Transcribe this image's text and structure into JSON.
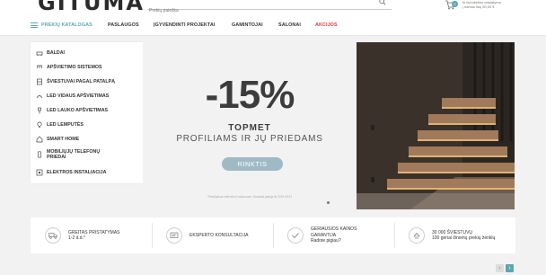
{
  "header": {
    "logo": "GITUMA",
    "search_placeholder": "Prekių paieška",
    "cart_count": "0",
    "cart_line1": "Iš išmokėtino pristatymo",
    "cart_line2": "į namus likę 50,00 €"
  },
  "nav": {
    "catalog": "PREKIŲ KATALOGAS",
    "items": [
      "PASLAUGOS",
      "ĮGYVENDINTI PROJEKTAI",
      "GAMINTOJAI",
      "SALONAI",
      "AKCIJOS"
    ]
  },
  "sidebar": {
    "items": [
      {
        "label": "BALDAI",
        "icon": "sofa-icon"
      },
      {
        "label": "APŠVIETIMO SISTEMOS",
        "icon": "track-light-icon"
      },
      {
        "label": "ŠVIESTUVAI PAGAL PATALPĄ",
        "icon": "lamp-icon"
      },
      {
        "label": "LED VIDAUS APŠVIETIMAS",
        "icon": "led-strip-icon"
      },
      {
        "label": "LED LAUKO APŠVIETIMAS",
        "icon": "outdoor-light-icon"
      },
      {
        "label": "LED LEMPUTĖS",
        "icon": "bulb-icon"
      },
      {
        "label": "SMART HOME",
        "icon": "smart-home-icon"
      },
      {
        "label": "MOBILIŲJŲ TELEFONŲ PRIEDAI",
        "icon": "phone-icon"
      },
      {
        "label": "ELEKTROS INSTALIACIJA",
        "icon": "switch-icon"
      }
    ]
  },
  "hero": {
    "discount": "-15%",
    "brand": "TOPMET",
    "subtitle": "PROFILIAMS IR JŲ PRIEDAMS",
    "button": "RINKTIS",
    "note": "*Pasiūlymas internetu ir salonuose. Nuolaida galioja iki 2019.09.31"
  },
  "features": [
    {
      "title": "GREITAS PRISTATYMAS",
      "text": "1-2 d.d.*",
      "icon": "truck-icon"
    },
    {
      "title": "EKSPERTO KONSULTACIJA",
      "text": "",
      "icon": "consult-icon"
    },
    {
      "title": "GERIAUSIOS KAINOS GARANTIJA",
      "text": "Radote pigiau?",
      "icon": "check-icon"
    },
    {
      "title": "30 000 ŠVIESTUVŲ",
      "text": "100 geriai žinomų prekių ženklų",
      "icon": "lamp-stock-icon"
    }
  ],
  "colors": {
    "accent": "#5ea5b4",
    "sale": "#e53935"
  }
}
